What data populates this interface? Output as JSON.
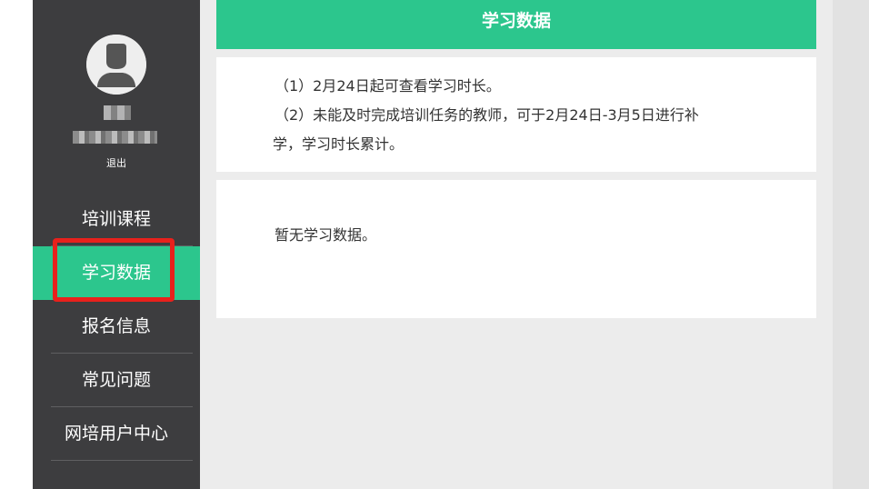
{
  "sidebar": {
    "logout_label": "退出",
    "items": [
      {
        "label": "培训课程",
        "active": false
      },
      {
        "label": "学习数据",
        "active": true
      },
      {
        "label": "报名信息",
        "active": false
      },
      {
        "label": "常见问题",
        "active": false
      },
      {
        "label": "网培用户中心",
        "active": false
      }
    ]
  },
  "main": {
    "title": "学习数据",
    "notices": {
      "line1": "（1）2月24日起可查看学习时长。",
      "line2a": "（2）未能及时完成培训任务的教师，可于2月24日-3月5日进行补",
      "line2b": "学，学习时长累计。"
    },
    "empty_message": "暂无学习数据。"
  },
  "colors": {
    "accent": "#2cc68d",
    "sidebar_bg": "#3d3d3f",
    "highlight": "#e8211c"
  }
}
